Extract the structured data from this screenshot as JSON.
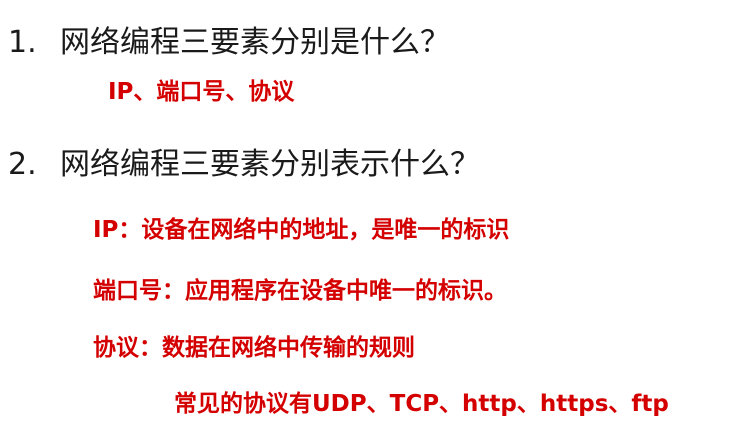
{
  "questions": [
    {
      "number": "1.",
      "text": "网络编程三要素分别是什么？",
      "answers": [
        "IP、端口号、协议"
      ]
    },
    {
      "number": "2.",
      "text": "网络编程三要素分别表示什么？",
      "answers": [
        "IP：设备在网络中的地址，是唯一的标识",
        "端口号：应用程序在设备中唯一的标识。",
        "协议：数据在网络中传输的规则",
        "常见的协议有UDP、TCP、http、https、ftp"
      ]
    }
  ],
  "colors": {
    "question_text": "#1a1a1a",
    "answer_text": "#d40000",
    "background": "#ffffff"
  }
}
